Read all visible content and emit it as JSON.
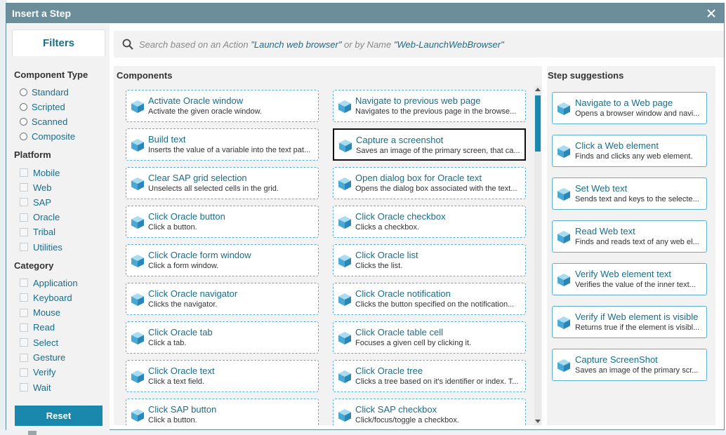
{
  "dialog": {
    "title": "Insert a Step"
  },
  "filters": {
    "tab_label": "Filters",
    "component_type": {
      "title": "Component Type",
      "options": [
        "Standard",
        "Scripted",
        "Scanned",
        "Composite"
      ]
    },
    "platform": {
      "title": "Platform",
      "options": [
        "Mobile",
        "Web",
        "SAP",
        "Oracle",
        "Tribal",
        "Utilities"
      ]
    },
    "category": {
      "title": "Category",
      "options": [
        "Application",
        "Keyboard",
        "Mouse",
        "Read",
        "Select",
        "Gesture",
        "Verify",
        "Wait"
      ]
    },
    "reset_label": "Reset"
  },
  "search": {
    "prefix": "Search based on an Action ",
    "action_example": "\"Launch web browser\"",
    "middle": " or by Name ",
    "name_example": "\"Web-LaunchWebBrowser\""
  },
  "components": {
    "title": "Components",
    "items": [
      {
        "name": "Activate Oracle window",
        "desc": "Activate the given oracle window."
      },
      {
        "name": "Navigate to previous web page",
        "desc": "Navigates to the previous page in the browse..."
      },
      {
        "name": "Build text",
        "desc": "Inserts the value of a variable into the text pat..."
      },
      {
        "name": "Capture a screenshot",
        "desc": "Saves an image of the primary screen, that ca..."
      },
      {
        "name": "Clear SAP grid selection",
        "desc": "Unselects all selected cells in the grid."
      },
      {
        "name": "Open dialog box for Oracle text",
        "desc": "Opens the dialog box associated with the text..."
      },
      {
        "name": "Click Oracle button",
        "desc": "Click a button."
      },
      {
        "name": "Click Oracle checkbox",
        "desc": "Clicks a checkbox."
      },
      {
        "name": "Click Oracle form window",
        "desc": "Click a form window."
      },
      {
        "name": "Click Oracle list",
        "desc": "Clicks the list."
      },
      {
        "name": "Click Oracle navigator",
        "desc": "Clicks the navigator."
      },
      {
        "name": "Click Oracle notification",
        "desc": "Clicks the button specified on the notification..."
      },
      {
        "name": "Click Oracle tab",
        "desc": "Click a tab."
      },
      {
        "name": "Click Oracle table cell",
        "desc": "Focuses a given cell by clicking it."
      },
      {
        "name": "Click Oracle text",
        "desc": "Click a text field."
      },
      {
        "name": "Click Oracle tree",
        "desc": "Clicks a tree based on it's identifier or index. T..."
      },
      {
        "name": "Click SAP button",
        "desc": "Click a button."
      },
      {
        "name": "Click SAP checkbox",
        "desc": "Click/focus/toggle a checkbox."
      }
    ]
  },
  "suggestions": {
    "title": "Step suggestions",
    "items": [
      {
        "name": "Navigate to a Web page",
        "desc": "Opens a browser window and navi..."
      },
      {
        "name": "Click a Web element",
        "desc": "Finds and clicks any web element."
      },
      {
        "name": "Set Web text",
        "desc": "Sends text and keys to the selecte..."
      },
      {
        "name": "Read Web text",
        "desc": "Finds and reads text of any web el..."
      },
      {
        "name": "Verify Web element text",
        "desc": "Verifies the value of the inner text..."
      },
      {
        "name": "Verify if Web element is visible",
        "desc": "Returns true if the element is visibl..."
      },
      {
        "name": "Capture ScreenShot",
        "desc": "Saves an image of the primary scr..."
      }
    ]
  },
  "colors": {
    "accent": "#1a88ad",
    "link": "#1a6d8a",
    "titlebar": "#6b8e9a",
    "highlight_border": "#111111"
  },
  "icons": {
    "component": "cube-icon",
    "search": "search-icon",
    "close": "close-icon"
  }
}
